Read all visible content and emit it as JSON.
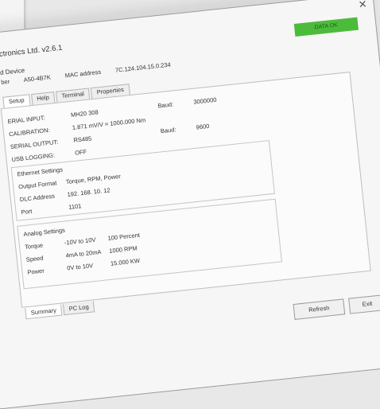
{
  "window": {
    "close_icon": "close-icon",
    "title": "ectronics Ltd. v2.6.1",
    "status_label": "DATA OK",
    "status_color": "#4cbb3c"
  },
  "device": {
    "label": "d Device",
    "number_label": "ber",
    "number_value": "A50-4B7K",
    "mac_label": "MAC address",
    "mac_value": "7C.124.104.15.0.234"
  },
  "tabs": [
    {
      "label": "Setup"
    },
    {
      "label": "Help"
    },
    {
      "label": "Terminal"
    },
    {
      "label": "Properties"
    }
  ],
  "setup": {
    "serial_input": {
      "label": "ERIAL INPUT:",
      "value": "MH20 308",
      "baud_label": "Baud:",
      "baud_value": "3000000"
    },
    "calibration": {
      "label": "CALIBRATION:",
      "value": "1.871 mV/V = 1000.000 Nm"
    },
    "serial_output": {
      "label": "SERIAL OUTPUT:",
      "value": "RS485",
      "baud_label": "Baud:",
      "baud_value": "9600"
    },
    "usb_logging": {
      "label": "USB LOGGING:",
      "value": "OFF"
    },
    "ethernet": {
      "title": "Ethernet Settings",
      "output_format_label": "Output Format",
      "output_format_value": "Torque, RPM, Power",
      "dlc_label": "DLC Address",
      "dlc_value": "192. 168. 10. 12",
      "port_label": "Port",
      "port_value": "1101"
    },
    "analog": {
      "title": "Analog Settings",
      "rows": [
        {
          "label": "Torque",
          "range": "-10V to 10V",
          "scale": "100 Percent"
        },
        {
          "label": "Speed",
          "range": "4mA to 20mA",
          "scale": "1000 RPM"
        },
        {
          "label": "Power",
          "range": "0V to 10V",
          "scale": "15.000 KW"
        }
      ]
    }
  },
  "bottom_tabs": [
    {
      "label": "Summary"
    },
    {
      "label": "PC Log"
    }
  ],
  "buttons": {
    "refresh": "Refresh",
    "exit": "Exit"
  }
}
